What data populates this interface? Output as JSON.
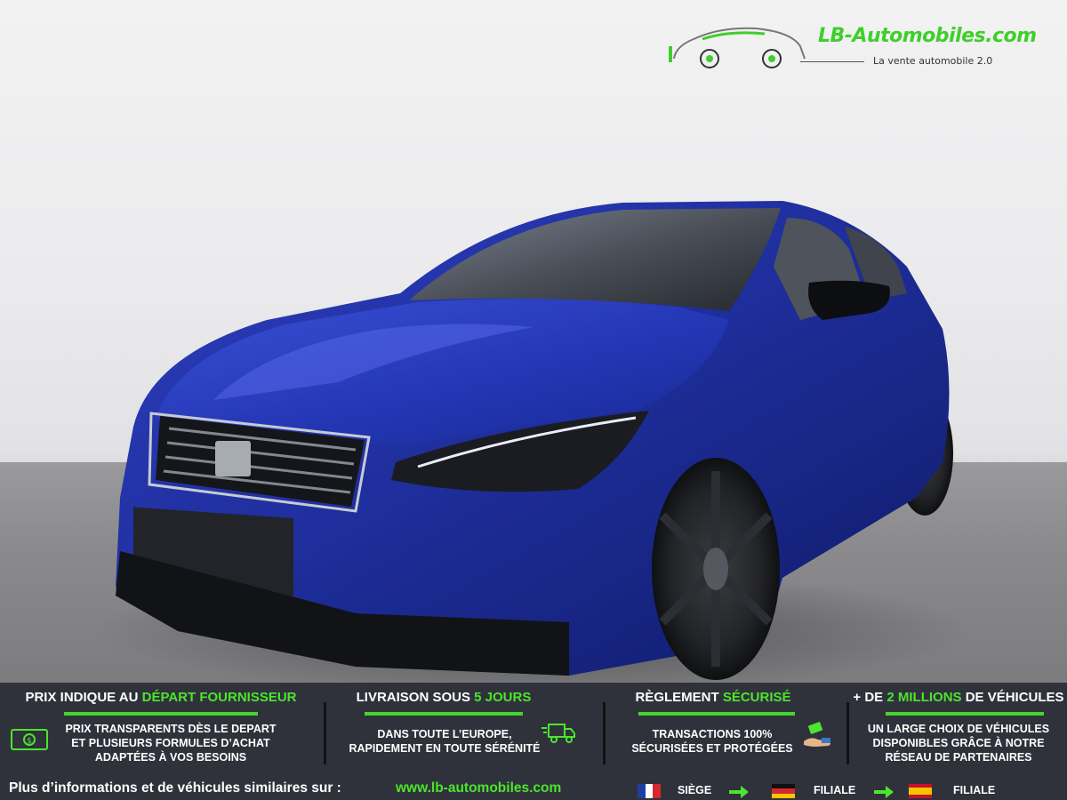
{
  "brand": {
    "name": "LB-Automobiles.com",
    "tagline": "La vente automobile 2.0",
    "accent_color": "#44d62c"
  },
  "car": {
    "color": "#1f2f9e"
  },
  "features": [
    {
      "title_prefix": "PRIX INDIQUE AU ",
      "title_highlight": "DÉPART FOURNISSEUR",
      "title_suffix": "",
      "lines": [
        "PRIX TRANSPARENTS DÈS LE DEPART",
        "ET PLUSIEURS FORMULES D’ACHAT",
        "ADAPTÉES À VOS BESOINS"
      ],
      "icon": "money-icon"
    },
    {
      "title_prefix": "LIVRAISON SOUS ",
      "title_highlight": "5 JOURS",
      "title_suffix": "",
      "lines": [
        "DANS TOUTE L’EUROPE,",
        "RAPIDEMENT EN TOUTE SÉRÉNITÉ"
      ],
      "icon": "delivery-truck-icon"
    },
    {
      "title_prefix": "RÈGLEMENT ",
      "title_highlight": "SÉCURISÉ",
      "title_suffix": "",
      "lines": [
        "TRANSACTIONS 100%",
        "SÉCURISÉES ET PROTÉGÉES"
      ],
      "icon": "payment-hand-icon"
    },
    {
      "title_prefix": "+ DE ",
      "title_highlight": "2 MILLIONS",
      "title_suffix": " DE VÉHICULES",
      "lines": [
        "UN LARGE CHOIX DE VÉHICULES",
        "DISPONIBLES GRÂCE À NOTRE",
        "RÉSEAU DE PARTENAIRES"
      ],
      "icon": ""
    }
  ],
  "footer": {
    "text": "Plus d’informations et de véhicules similaires sur :",
    "url": "www.lb-automobiles.com",
    "locations": [
      {
        "flag": "france-flag-icon",
        "label": "SIÈGE"
      },
      {
        "flag": "germany-flag-icon",
        "label": "FILIALE"
      },
      {
        "flag": "spain-flag-icon",
        "label": "FILIALE"
      }
    ]
  }
}
